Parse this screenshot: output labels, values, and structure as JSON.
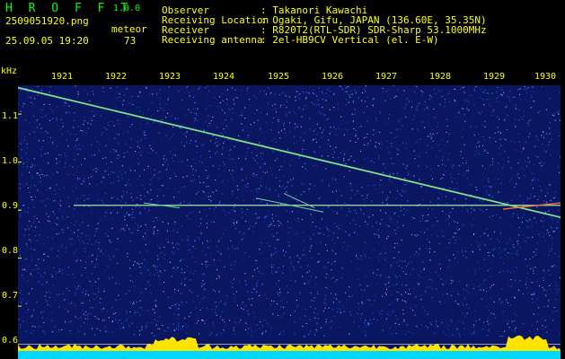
{
  "app": {
    "name": "H R O F F T",
    "version": "1.0.0"
  },
  "info": {
    "filename": "2509051920.png",
    "datetime": "25.09.05 19:20",
    "meteor_label": "meteor",
    "meteor_count": "73"
  },
  "station": {
    "observer_label": "Observer",
    "observer_value": ": Takanori Kawachi",
    "location_label": "Receiving Location",
    "location_value": ": Ogaki, Gifu, JAPAN (136.60E, 35.35N)",
    "receiver_label": "Receiver",
    "receiver_value": ": R820T2(RTL-SDR) SDR-Sharp 53.1000MHz",
    "antenna_label": "Receiving antenna",
    "antenna_value": ": 2el-HB9CV Vertical (el. E-W)"
  },
  "chart_data": {
    "type": "heatmap",
    "ylabel": "kHz",
    "yticks": [
      "1.1",
      "1.0",
      "0.9",
      "0.8",
      "0.7",
      "0.6"
    ],
    "ytick_values": [
      1.1,
      1.0,
      0.9,
      0.8,
      0.7,
      0.6
    ],
    "xticks": [
      "1921",
      "1922",
      "1923",
      "1924",
      "1925",
      "1926",
      "1927",
      "1928",
      "1929",
      "1930"
    ],
    "ylim": [
      0.59,
      1.16
    ],
    "carrier_khz": 0.91,
    "trace": {
      "start_khz": 1.155,
      "end_khz": 0.885
    }
  }
}
